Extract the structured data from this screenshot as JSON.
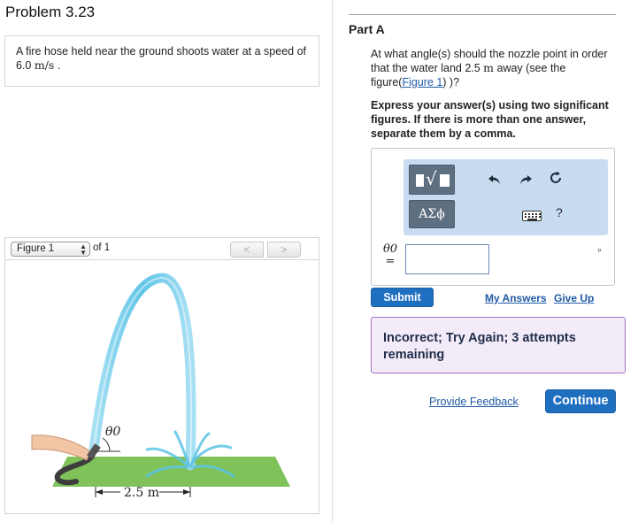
{
  "problem": {
    "title": "Problem 3.23",
    "statement_prefix": "A fire hose held near the ground shoots water at a speed of 6.0 ",
    "statement_unit": "m/s",
    "statement_suffix": " ."
  },
  "figure_nav": {
    "selected": "Figure 1",
    "of_label": "of 1",
    "prev_label": "<",
    "next_label": ">"
  },
  "figure": {
    "angle_label": "θ0",
    "distance_label": "2.5 m"
  },
  "part": {
    "label": "Part A",
    "question_prefix": "At what angle(s) should the nozzle point in order that the water land 2.5 ",
    "question_unit": "m",
    "question_middle": " away (see the figure(",
    "figure_link": "Figure 1",
    "question_suffix": ") )?",
    "instructions": "Express your answer(s) using two significant figures. If there is more than one answer, separate them by a comma."
  },
  "toolbar": {
    "greek_label": "ΑΣϕ",
    "undo_icon": "undo-arrow",
    "redo_icon": "redo-arrow",
    "reset_icon": "reset-circle",
    "keyboard_icon": "keyboard",
    "help_label": "?"
  },
  "answer": {
    "variable_label": "θ0",
    "equals": "=",
    "value": "",
    "unit_symbol": "∘"
  },
  "actions": {
    "submit": "Submit",
    "my_answers": "My Answers",
    "give_up": "Give Up",
    "provide_feedback": "Provide Feedback",
    "continue": "Continue"
  },
  "feedback": {
    "message": "Incorrect; Try Again; 3 attempts remaining"
  },
  "colors": {
    "primary_button": "#1f6fc0",
    "link": "#1f5aa6",
    "toolbar_bg": "#c8dcf1",
    "feedback_border": "#a46ec7",
    "feedback_bg": "#f3ebf8",
    "water": "#5cc4e6",
    "ground": "#7fc25a"
  }
}
